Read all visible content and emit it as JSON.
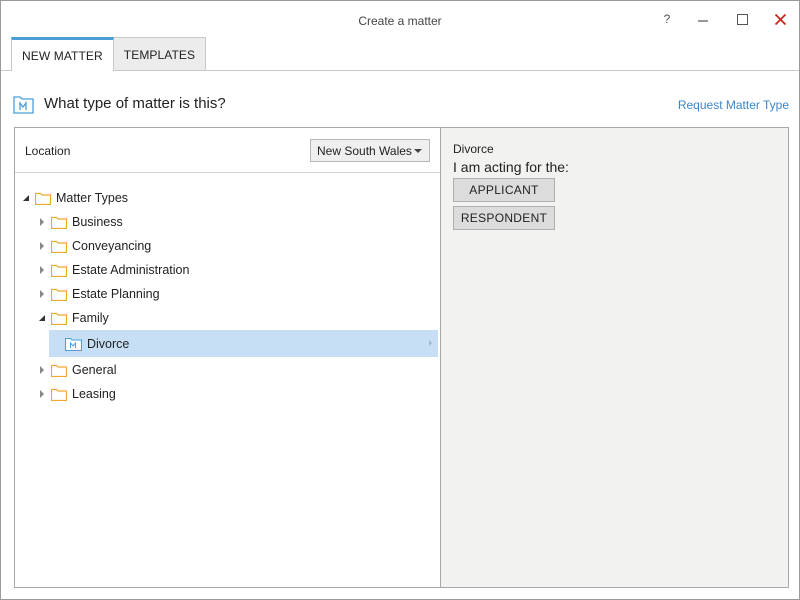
{
  "window": {
    "title": "Create a matter",
    "help_glyph": "?",
    "minimize_glyph": "–",
    "maximize_glyph": "☐",
    "close_glyph": "✕",
    "close_color": "#c42b1c"
  },
  "tabs": [
    {
      "label": "NEW MATTER",
      "active": true
    },
    {
      "label": "TEMPLATES",
      "active": false
    }
  ],
  "header": {
    "question": "What type of matter is this?",
    "request_link": "Request Matter Type",
    "icon": "matter-type-icon"
  },
  "location": {
    "label": "Location",
    "selected": "New South Wales"
  },
  "tree": {
    "root": {
      "label": "Matter Types",
      "expanded": true
    },
    "items": [
      {
        "label": "Business",
        "expanded": false
      },
      {
        "label": "Conveyancing",
        "expanded": false
      },
      {
        "label": "Estate Administration",
        "expanded": false
      },
      {
        "label": "Estate Planning",
        "expanded": false
      },
      {
        "label": "Family",
        "expanded": true
      },
      {
        "label": "Divorce",
        "selected": true,
        "leaf": true
      },
      {
        "label": "General",
        "expanded": false
      },
      {
        "label": "Leasing",
        "expanded": false
      }
    ]
  },
  "detail": {
    "title": "Divorce",
    "acting_label": "I am acting for the:",
    "buttons": {
      "applicant": "APPLICANT",
      "respondent": "RESPONDENT"
    }
  },
  "colors": {
    "accent": "#4a9fd8",
    "link": "#3b86c6",
    "selection": "#c6dff5",
    "folder": "#f0a830",
    "matter_icon": "#4a9fd8"
  }
}
